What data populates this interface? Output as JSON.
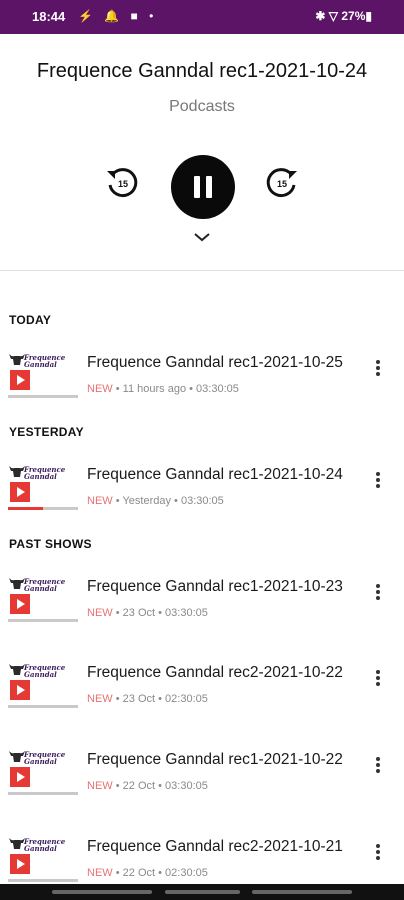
{
  "status_bar": {
    "time": "18:44",
    "left_icons": "⚡ 🔔 ■ •",
    "right_icons": "✱ ▽ 27%▮"
  },
  "player": {
    "title": "Frequence Ganndal rec1-2021-10-24",
    "subtitle": "Podcasts",
    "rewind_seconds": "15",
    "forward_seconds": "15"
  },
  "sections": {
    "today": "TODAY",
    "yesterday": "YESTERDAY",
    "past": "PAST SHOWS"
  },
  "thumb_logo": [
    "Frequence",
    "Ganndal"
  ],
  "episodes": [
    {
      "title": "Frequence Ganndal rec1-2021-10-25",
      "badge": "NEW",
      "when": "11 hours ago",
      "duration": "03:30:05",
      "progress": 0.0
    },
    {
      "title": "Frequence Ganndal rec1-2021-10-24",
      "badge": "NEW",
      "when": "Yesterday",
      "duration": "03:30:05",
      "progress": 0.5
    },
    {
      "title": "Frequence Ganndal rec1-2021-10-23",
      "badge": "NEW",
      "when": "23 Oct",
      "duration": "03:30:05",
      "progress": 0.0
    },
    {
      "title": "Frequence Ganndal rec2-2021-10-22",
      "badge": "NEW",
      "when": "23 Oct",
      "duration": "02:30:05",
      "progress": 0.0
    },
    {
      "title": "Frequence Ganndal rec1-2021-10-22",
      "badge": "NEW",
      "when": "22 Oct",
      "duration": "03:30:05",
      "progress": 0.0
    },
    {
      "title": "Frequence Ganndal rec2-2021-10-21",
      "badge": "NEW",
      "when": "22 Oct",
      "duration": "02:30:05",
      "progress": 0.0
    }
  ],
  "colors": {
    "status_bar": "#5b1466",
    "accent_red": "#e53935",
    "new_badge": "#e57373"
  },
  "icons": {
    "rewind": "rewind-15-icon",
    "forward": "forward-15-icon",
    "pause": "pause-icon",
    "collapse": "chevron-down-icon",
    "more": "more-vert-icon",
    "play": "play-icon"
  }
}
